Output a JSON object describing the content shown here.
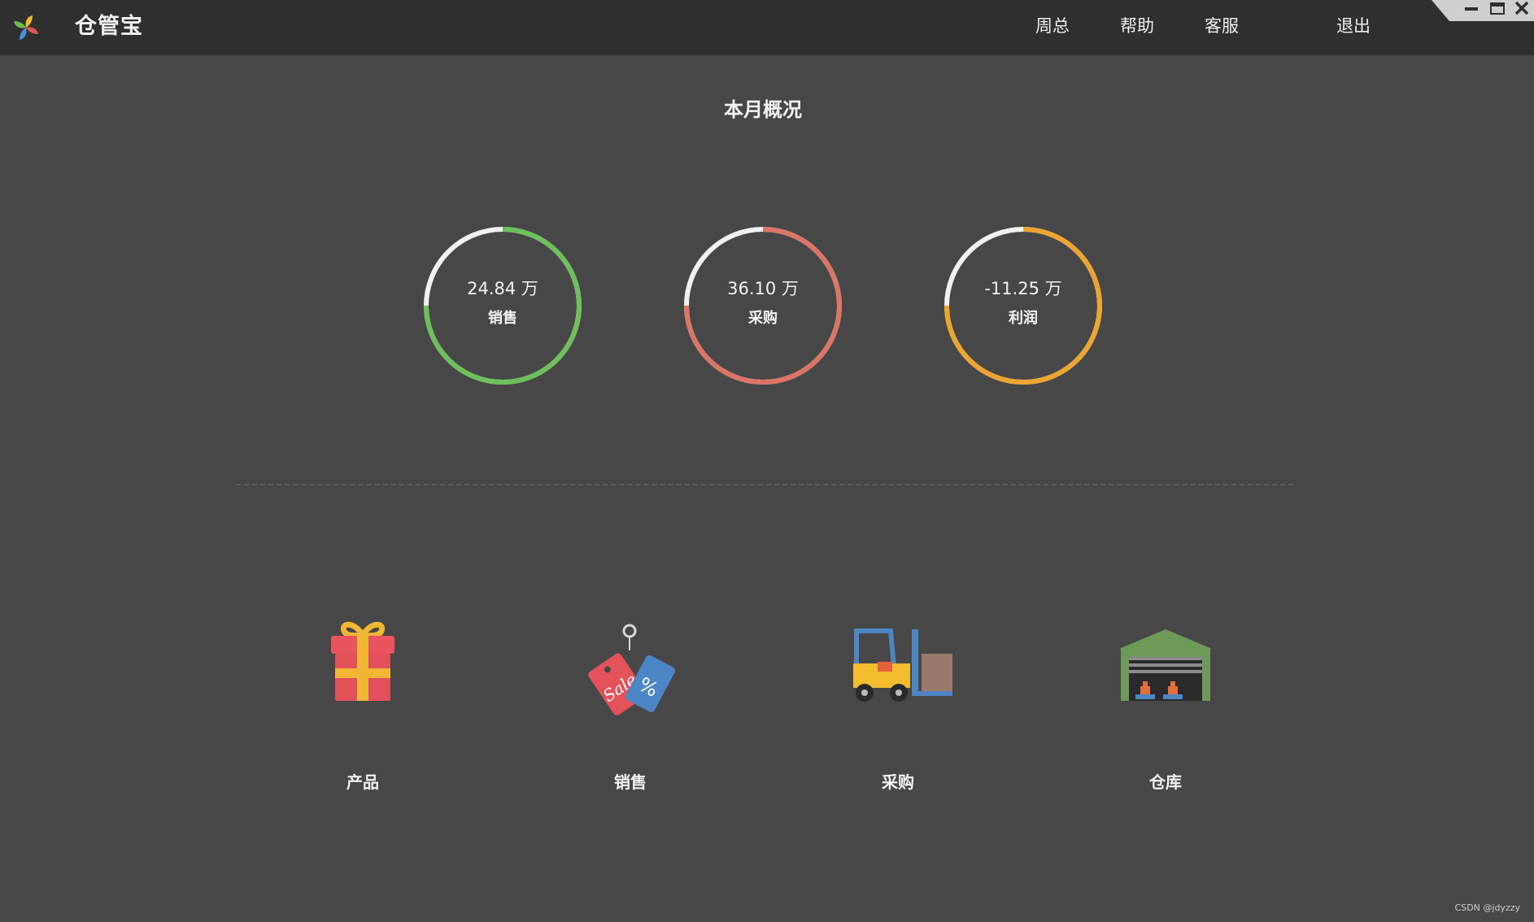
{
  "app": {
    "title": "仓管宝"
  },
  "nav": {
    "items": [
      {
        "label": "周总"
      },
      {
        "label": "帮助"
      },
      {
        "label": "客服"
      },
      {
        "label": "退出"
      }
    ]
  },
  "overview": {
    "title": "本月概况",
    "stats": [
      {
        "value": "24.84 万",
        "label": "销售",
        "color": "#6dc15a",
        "fill": 0.75
      },
      {
        "value": "36.10 万",
        "label": "采购",
        "color": "#dc7566",
        "fill": 0.75
      },
      {
        "value": "-11.25 万",
        "label": "利润",
        "color": "#eda531",
        "fill": 0.75
      }
    ]
  },
  "modules": [
    {
      "label": "产品",
      "icon": "gift-icon"
    },
    {
      "label": "销售",
      "icon": "sale-tag-icon"
    },
    {
      "label": "采购",
      "icon": "forklift-icon"
    },
    {
      "label": "仓库",
      "icon": "warehouse-icon"
    }
  ],
  "colors": {
    "background": "#474747",
    "topbar": "#2f2f2f",
    "ring_track": "#f1f1f1"
  },
  "watermark": "CSDN @jdyzzy"
}
